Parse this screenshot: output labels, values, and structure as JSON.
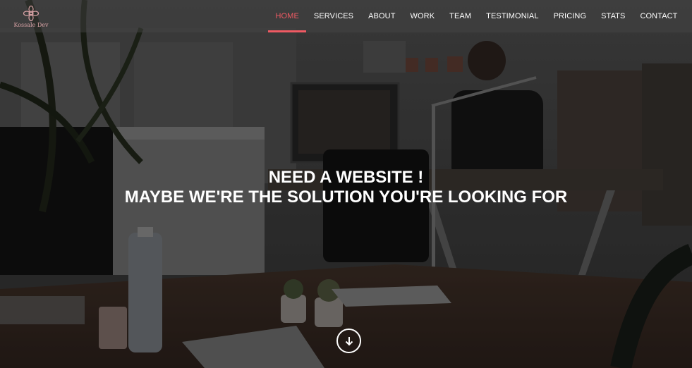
{
  "brand": {
    "name": "Kossale Dev",
    "logo_icon": "flower-logo-icon",
    "accent": "#d9a3a6"
  },
  "nav": {
    "items": [
      {
        "label": "HOME",
        "active": true
      },
      {
        "label": "SERVICES",
        "active": false
      },
      {
        "label": "ABOUT",
        "active": false
      },
      {
        "label": "WORK",
        "active": false
      },
      {
        "label": "TEAM",
        "active": false
      },
      {
        "label": "TESTIMONIAL",
        "active": false
      },
      {
        "label": "PRICING",
        "active": false
      },
      {
        "label": "STATS",
        "active": false
      },
      {
        "label": "CONTACT",
        "active": false
      }
    ],
    "active_color": "#ef5a63"
  },
  "hero": {
    "line1": "NEED A WEBSITE !",
    "line2": "MAYBE WE'RE THE SOLUTION YOU'RE LOOKING FOR",
    "scroll_icon": "arrow-down-circle-icon"
  }
}
